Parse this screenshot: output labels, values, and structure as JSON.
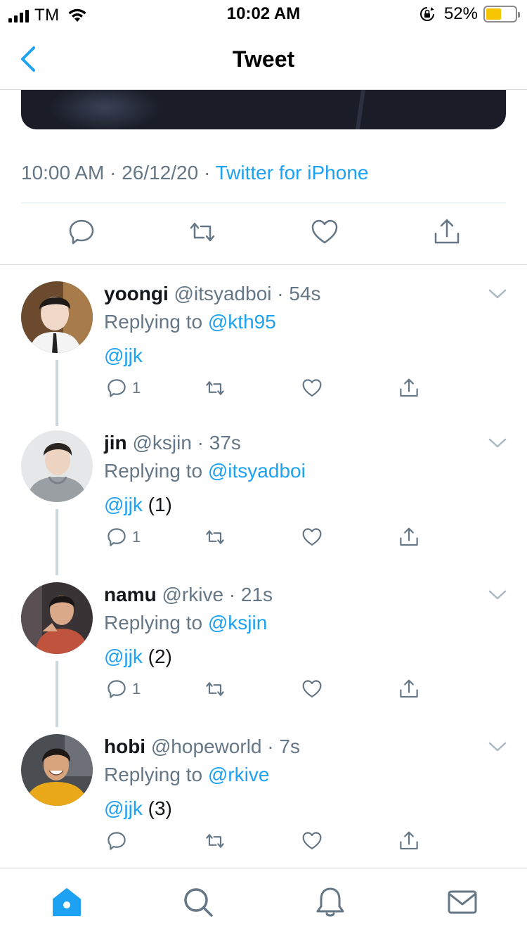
{
  "status_bar": {
    "carrier": "TM",
    "time": "10:02 AM",
    "battery_percent": "52%",
    "battery_level": 0.52,
    "battery_color": "#f6c700"
  },
  "nav": {
    "title": "Tweet",
    "back_icon": "chevron-left-icon"
  },
  "tweet_meta": {
    "time": "10:00 AM",
    "date": "26/12/20",
    "source": "Twitter for iPhone"
  },
  "main_actions": [
    "reply-icon",
    "retweet-icon",
    "like-icon",
    "share-icon"
  ],
  "replies": [
    {
      "name": "yoongi",
      "handle": "@itsyadboi",
      "time": "54s",
      "replying_prefix": "Replying to",
      "replying_to": "@kth95",
      "mention": "@jjk",
      "suffix": "",
      "reply_count": "1"
    },
    {
      "name": "jin",
      "handle": "@ksjin",
      "time": "37s",
      "replying_prefix": "Replying to",
      "replying_to": "@itsyadboi",
      "mention": "@jjk",
      "suffix": "(1)",
      "reply_count": "1"
    },
    {
      "name": "namu",
      "handle": "@rkive",
      "time": "21s",
      "replying_prefix": "Replying to",
      "replying_to": "@ksjin",
      "mention": "@jjk",
      "suffix": "(2)",
      "reply_count": "1"
    },
    {
      "name": "hobi",
      "handle": "@hopeworld",
      "time": "7s",
      "replying_prefix": "Replying to",
      "replying_to": "@rkive",
      "mention": "@jjk",
      "suffix": "(3)",
      "reply_count": ""
    }
  ],
  "tab_bar": [
    "home-icon",
    "search-icon",
    "notifications-icon",
    "messages-icon"
  ],
  "colors": {
    "accent": "#1da1f2",
    "secondary_text": "#657786",
    "primary_text": "#14171a",
    "thread_line": "#ccd6dd"
  }
}
